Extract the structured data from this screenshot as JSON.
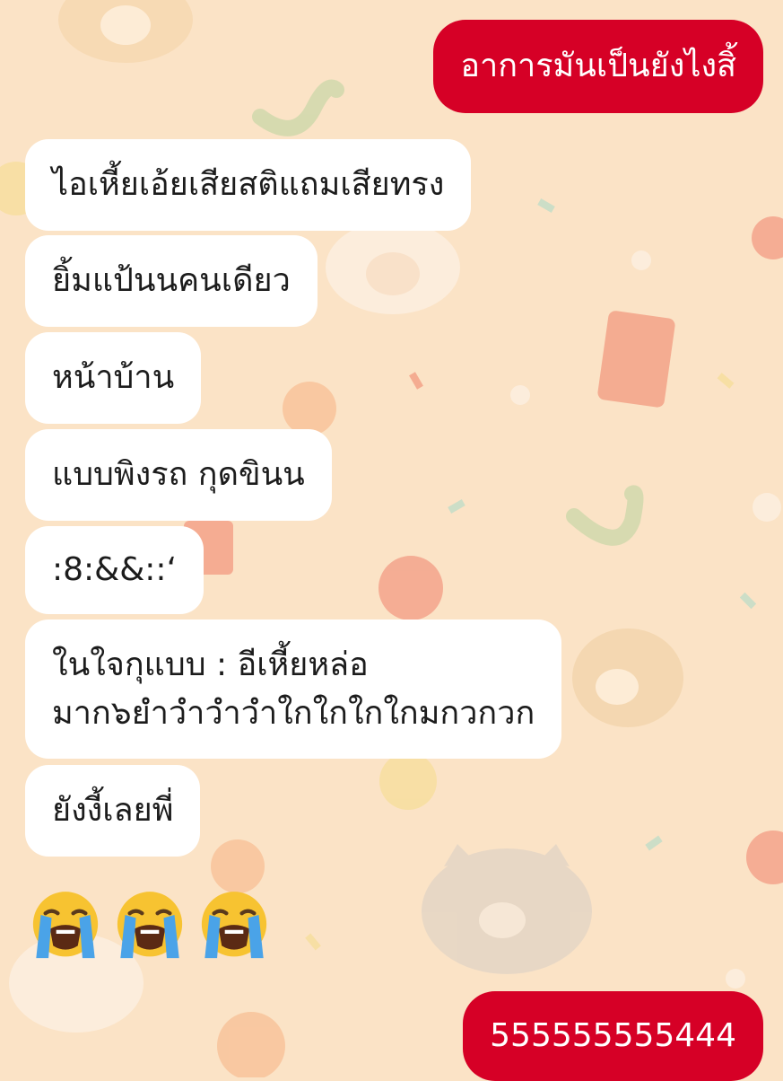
{
  "chat": {
    "messages": [
      {
        "side": "out",
        "text": "อาการมันเป็นยังไงสิ้"
      },
      {
        "side": "in",
        "text": "ไอเหี้ยเอ้ยเสียสติแถมเสียทรง"
      },
      {
        "side": "in",
        "text": "ยิ้มแป้นนคนเดียว"
      },
      {
        "side": "in",
        "text": "หน้าบ้าน"
      },
      {
        "side": "in",
        "text": "แบบพิงรถ กุดขินน"
      },
      {
        "side": "in",
        "text": ":8:&&::‘"
      },
      {
        "side": "in",
        "lines": [
          "ในใจกุแบบ : อีเหี้ยหล่อ",
          "มาก๖ยำวำวำวำใกใกใกใกมกวกวก"
        ]
      },
      {
        "side": "in",
        "text": "ยังงี้เลยพี่"
      },
      {
        "side": "in",
        "emoji": [
          "loudly-crying-face",
          "loudly-crying-face",
          "loudly-crying-face"
        ]
      },
      {
        "side": "out",
        "text": "555555555444"
      }
    ]
  },
  "colors": {
    "background": "#fbe3c6",
    "incoming_bubble": "#ffffff",
    "outgoing_bubble": "#d60026",
    "emoji_face": "#f7c331",
    "emoji_tears": "#4aa3e8"
  }
}
